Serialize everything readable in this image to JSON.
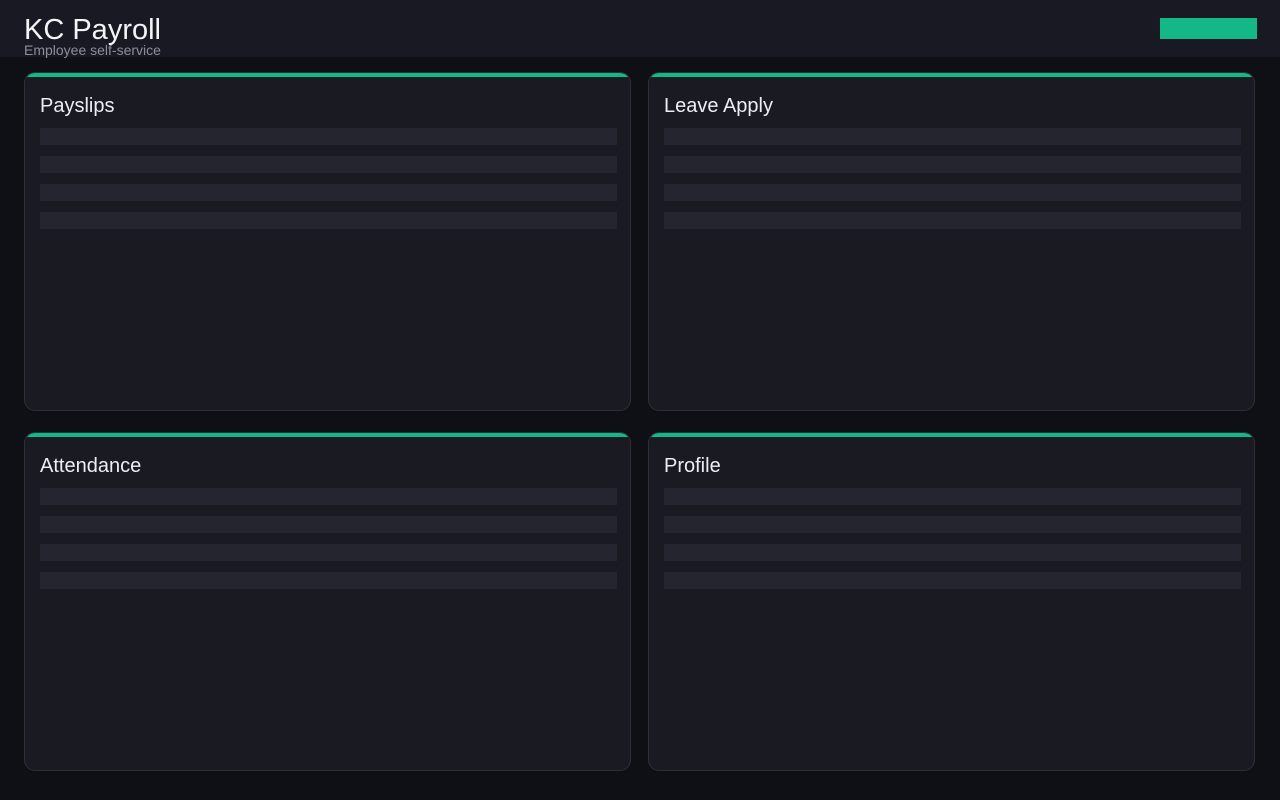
{
  "header": {
    "title": "KC Payroll",
    "subtitle": "Employee self-service",
    "action_button_color": "#13b886"
  },
  "cards": [
    {
      "title": "Payslips"
    },
    {
      "title": "Leave Apply"
    },
    {
      "title": "Attendance"
    },
    {
      "title": "Profile"
    }
  ],
  "theme": {
    "background": "#0f1015",
    "surface": "#1a1a23",
    "accent": "#13b886",
    "placeholder": "#252530"
  }
}
